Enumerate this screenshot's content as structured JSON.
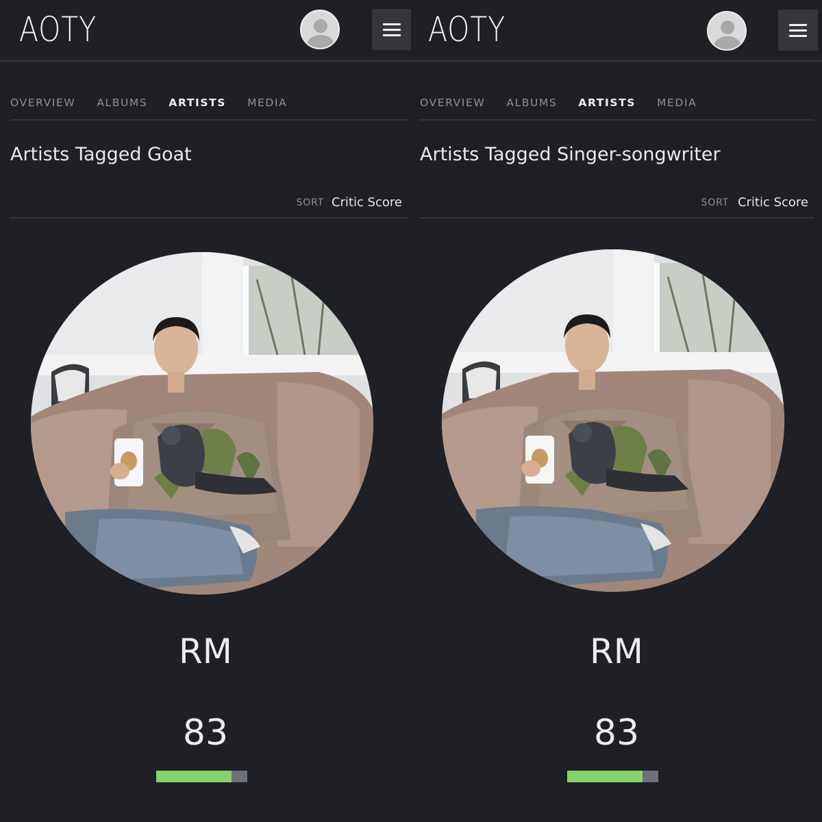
{
  "panels": [
    {
      "logo": "AOTY",
      "tabs": [
        "OVERVIEW",
        "ALBUMS",
        "ARTISTS",
        "MEDIA"
      ],
      "active_tab": "ARTISTS",
      "page_title": "Artists Tagged Goat",
      "sort_label": "SORT",
      "sort_value": "Critic Score",
      "artist": {
        "name": "RM",
        "score": "83",
        "score_fraction": 0.83
      }
    },
    {
      "logo": "AOTY",
      "tabs": [
        "OVERVIEW",
        "ALBUMS",
        "ARTISTS",
        "MEDIA"
      ],
      "active_tab": "ARTISTS",
      "page_title": "Artists Tagged Singer-songwriter",
      "sort_label": "SORT",
      "sort_value": "Critic Score",
      "artist": {
        "name": "RM",
        "score": "83",
        "score_fraction": 0.83
      }
    }
  ],
  "colors": {
    "background": "#1f2025",
    "divider": "#34363c",
    "score_fill": "#85d36a",
    "score_track": "#6e7077",
    "tab_inactive": "#8d8f95",
    "text": "#ececec"
  },
  "icons": {
    "avatar": "user-avatar-icon",
    "menu": "hamburger-menu-icon"
  }
}
